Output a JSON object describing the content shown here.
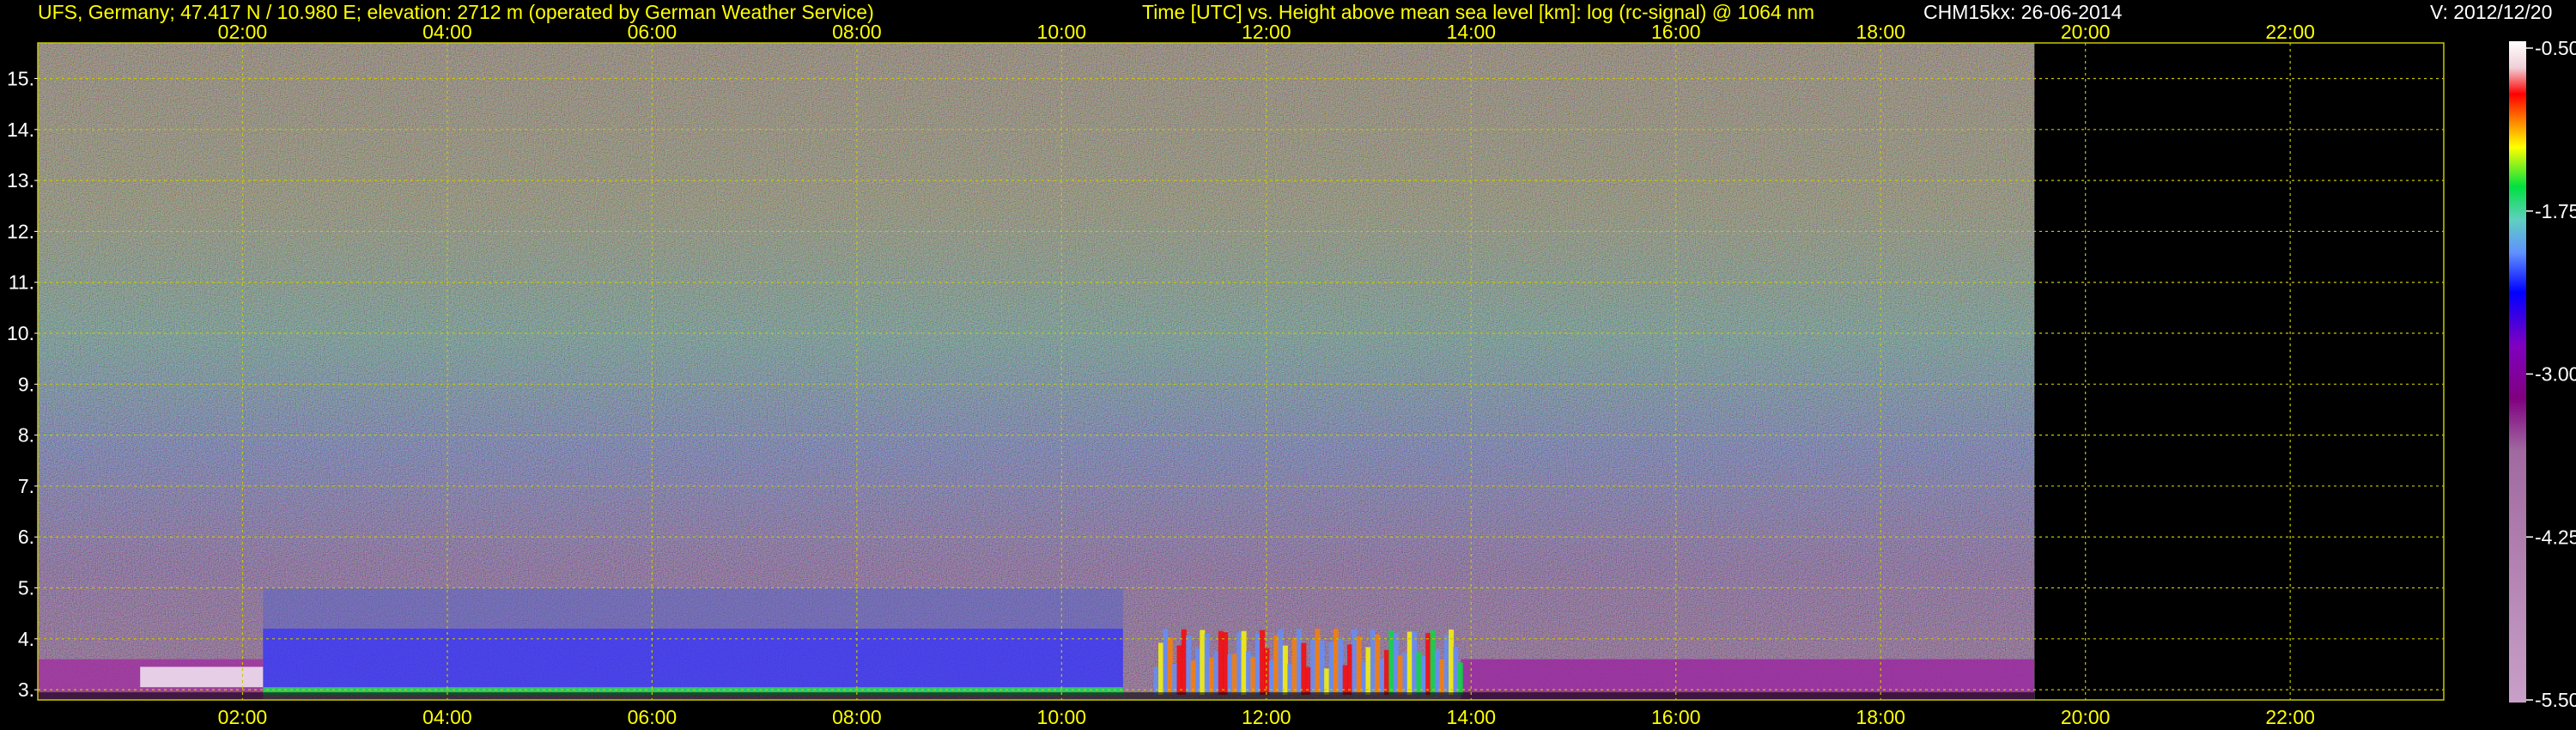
{
  "header": {
    "left": "UFS, Germany; 47.417 N / 10.980 E; elevation: 2712 m  (operated by German Weather Service)",
    "center": "Time [UTC] vs. Height above mean sea level [km]: log (rc-signal) @ 1064 nm",
    "instrument": "CHM15kx: 26-06-2014",
    "version": "V: 2012/12/20"
  },
  "chart_data": {
    "type": "heatmap",
    "title": "Time [UTC] vs. Height above mean sea level [km]: log (rc-signal) @ 1064 nm",
    "xlabel": "",
    "ylabel": "",
    "x_ticks": [
      "02:00",
      "04:00",
      "06:00",
      "08:00",
      "10:00",
      "12:00",
      "14:00",
      "16:00",
      "18:00",
      "20:00",
      "22:00"
    ],
    "x_tick_hours": [
      2,
      4,
      6,
      8,
      10,
      12,
      14,
      16,
      18,
      20,
      22
    ],
    "xlim_hours": [
      0,
      23.5
    ],
    "data_end_hour": 19.5,
    "y_ticks": [
      "3.",
      "4.",
      "5.",
      "6.",
      "7.",
      "8.",
      "9.",
      "10.",
      "11.",
      "12.",
      "13.",
      "14.",
      "15."
    ],
    "y_tick_values": [
      3,
      4,
      5,
      6,
      7,
      8,
      9,
      10,
      11,
      12,
      13,
      14,
      15
    ],
    "ylim_km": [
      2.8,
      15.7
    ],
    "grid": true,
    "colorbar": {
      "labels": [
        "-0.50",
        "-1.75",
        "-3.00",
        "-4.25",
        "-5.50"
      ],
      "values": [
        -0.5,
        -1.75,
        -3.0,
        -4.25,
        -5.5
      ],
      "range": [
        -5.5,
        -0.5
      ],
      "colors": [
        "#ffffff",
        "#f0d0d8",
        "#ff0000",
        "#ff7f00",
        "#ffff00",
        "#00e040",
        "#60d0c0",
        "#6090ff",
        "#0000ff",
        "#8000c0",
        "#800080",
        "#a06aa0",
        "#c8a0c8"
      ]
    }
  },
  "colors": {
    "text": "#ffff00",
    "grid": "#c8c800",
    "background": "#000000"
  }
}
